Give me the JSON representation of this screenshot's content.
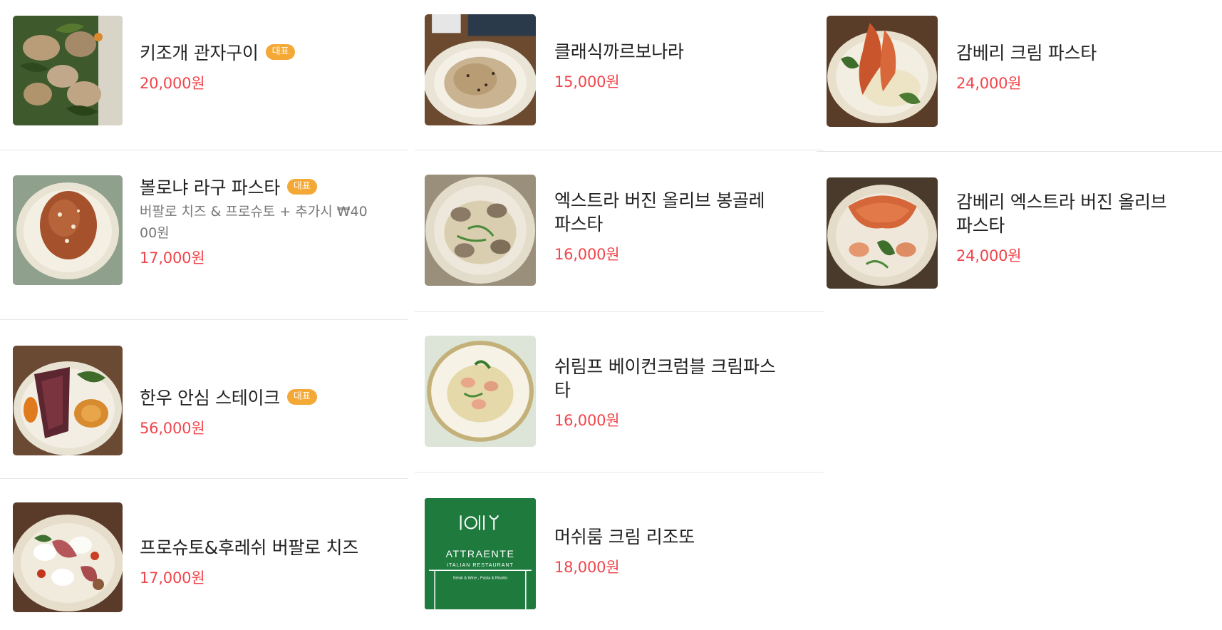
{
  "badge_label": "대표",
  "accent_color": "#f0454b",
  "badge_color": "#f4a836",
  "columns": [
    [
      {
        "name": "키조개 관자구이",
        "badge": true,
        "price": "20,000원",
        "image": "scallop-dish-image"
      },
      {
        "name": "볼로냐 라구 파스타",
        "badge": true,
        "desc_line1": "버팔로 치즈 & 프로슈토 + 추가시 ₩40",
        "desc_line2": "00원",
        "price": "17,000원",
        "image": "bolognese-pasta-image"
      },
      {
        "name": "한우 안심 스테이크",
        "badge": true,
        "price": "56,000원",
        "image": "steak-dish-image"
      },
      {
        "name": "프로슈토&후레쉬 버팔로 치즈",
        "badge": false,
        "price": "17,000원",
        "image": "prosciutto-cheese-image"
      }
    ],
    [
      {
        "name": "클래식까르보나라",
        "badge": false,
        "price": "15,000원",
        "image": "carbonara-image"
      },
      {
        "name_line1": "엑스트라 버진 올리브 봉골레",
        "name_line2": "파스타",
        "badge": false,
        "price": "16,000원",
        "image": "vongole-pasta-image"
      },
      {
        "name_line1": "쉬림프 베이컨크럼블 크림파스",
        "name_line2": "타",
        "badge": false,
        "price": "16,000원",
        "image": "shrimp-cream-pasta-image"
      },
      {
        "name": "머쉬룸 크림 리조또",
        "badge": false,
        "price": "18,000원",
        "image": "restaurant-logo-image",
        "logo": {
          "title": "ATTRAENTE",
          "subtitle": "ITALIAN RESTAURANT",
          "tagline": "Steak & Wine , Pasta & Risotto"
        }
      }
    ],
    [
      {
        "name": "감베리 크림 파스타",
        "badge": false,
        "price": "24,000원",
        "image": "gamberi-cream-pasta-image"
      },
      {
        "name_line1": "감베리 엑스트라 버진 올리브",
        "name_line2": "파스타",
        "badge": false,
        "price": "24,000원",
        "image": "gamberi-olive-pasta-image"
      }
    ]
  ]
}
